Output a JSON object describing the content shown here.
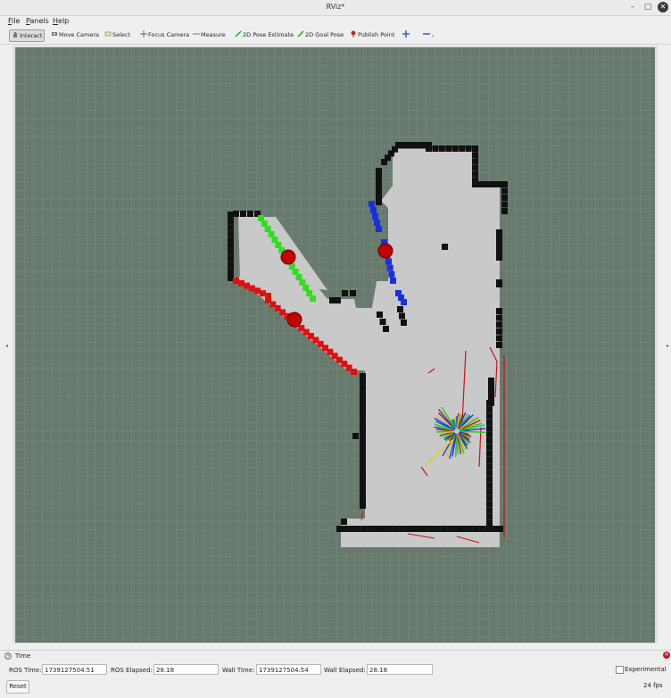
{
  "window": {
    "title": "RViz*"
  },
  "menu": [
    {
      "label": "File",
      "mnemonic": "F",
      "rest": "ile"
    },
    {
      "label": "Panels",
      "mnemonic": "P",
      "rest": "anels"
    },
    {
      "label": "Help",
      "mnemonic": "H",
      "rest": "elp"
    }
  ],
  "toolbar": {
    "interact": "Interact",
    "move_camera": "Move Camera",
    "select": "Select",
    "focus_camera": "Focus Camera",
    "measure": "Measure",
    "pose_estimate": "2D Pose Estimate",
    "goal_pose": "2D Goal Pose",
    "publish_point": "Publish Point"
  },
  "colors": {
    "grid_bg": "#687a6d",
    "free_space": "#c9c9c9",
    "occupied": "#111111",
    "boundary_green": "#33dd22",
    "boundary_blue": "#1a2fdd",
    "boundary_red": "#dd1111",
    "marker_red": "#c20000"
  },
  "time_panel": {
    "title": "Time",
    "ros_time_label": "ROS Time:",
    "ros_time": "1739127504.51",
    "ros_elapsed_label": "ROS Elapsed:",
    "ros_elapsed": "28.18",
    "wall_time_label": "Wall Time:",
    "wall_time": "1739127504.54",
    "wall_elapsed_label": "Wall Elapsed:",
    "wall_elapsed": "28.18",
    "experimental_label": "Experimental",
    "reset_label": "Reset",
    "fps": "24 fps"
  }
}
